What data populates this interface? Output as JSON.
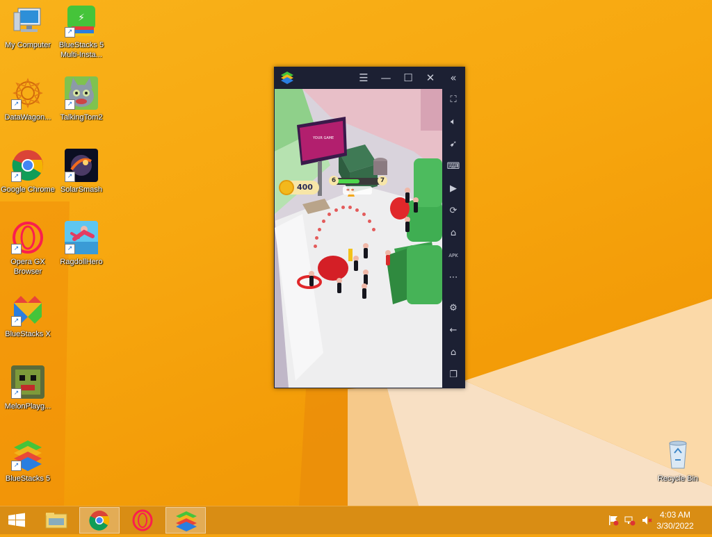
{
  "desktop": {
    "icons": [
      {
        "label": "My Computer",
        "icon": "computer-icon"
      },
      {
        "label": "BlueStacks 5 Multi-Insta...",
        "icon": "bluestacks-multi-instance-icon"
      },
      {
        "label": "DataWagon...",
        "icon": "datawagon-icon"
      },
      {
        "label": "TalkingTom2",
        "icon": "talking-tom-icon"
      },
      {
        "label": "Google Chrome",
        "icon": "chrome-icon"
      },
      {
        "label": "SolarSmash",
        "icon": "solar-smash-icon"
      },
      {
        "label": "Opera GX Browser",
        "icon": "opera-gx-icon"
      },
      {
        "label": "RagdollHero",
        "icon": "ragdoll-hero-icon"
      },
      {
        "label": "BlueStacks X",
        "icon": "bluestacks-x-icon"
      },
      {
        "label": "MelonPlayg...",
        "icon": "melon-playground-icon"
      },
      {
        "label": "BlueStacks 5",
        "icon": "bluestacks-icon"
      },
      {
        "label": "Recycle Bin",
        "icon": "recycle-bin-icon"
      }
    ]
  },
  "bluestacks": {
    "titlebar_buttons": [
      "menu-icon",
      "minimize-icon",
      "maximize-icon",
      "close-icon",
      "collapse-sidebar-icon"
    ],
    "sidebar_buttons": [
      "fullscreen-icon",
      "volume-icon",
      "pointer-icon",
      "keyboard-icon",
      "macro-icon",
      "rotate-icon",
      "build-icon",
      "apk-icon",
      "more-icon",
      "settings-icon",
      "back-icon",
      "home-icon",
      "recent-apps-icon"
    ],
    "apk_label": "APK",
    "game": {
      "coins": "400",
      "level_current": "6",
      "level_next": "7",
      "level_progress": 0.55
    }
  },
  "taskbar": {
    "apps": [
      "start-button",
      "file-explorer",
      "google-chrome",
      "opera-gx",
      "bluestacks"
    ],
    "active_app": "bluestacks"
  },
  "clock": {
    "time": "4:03 AM",
    "date": "3/30/2022"
  }
}
